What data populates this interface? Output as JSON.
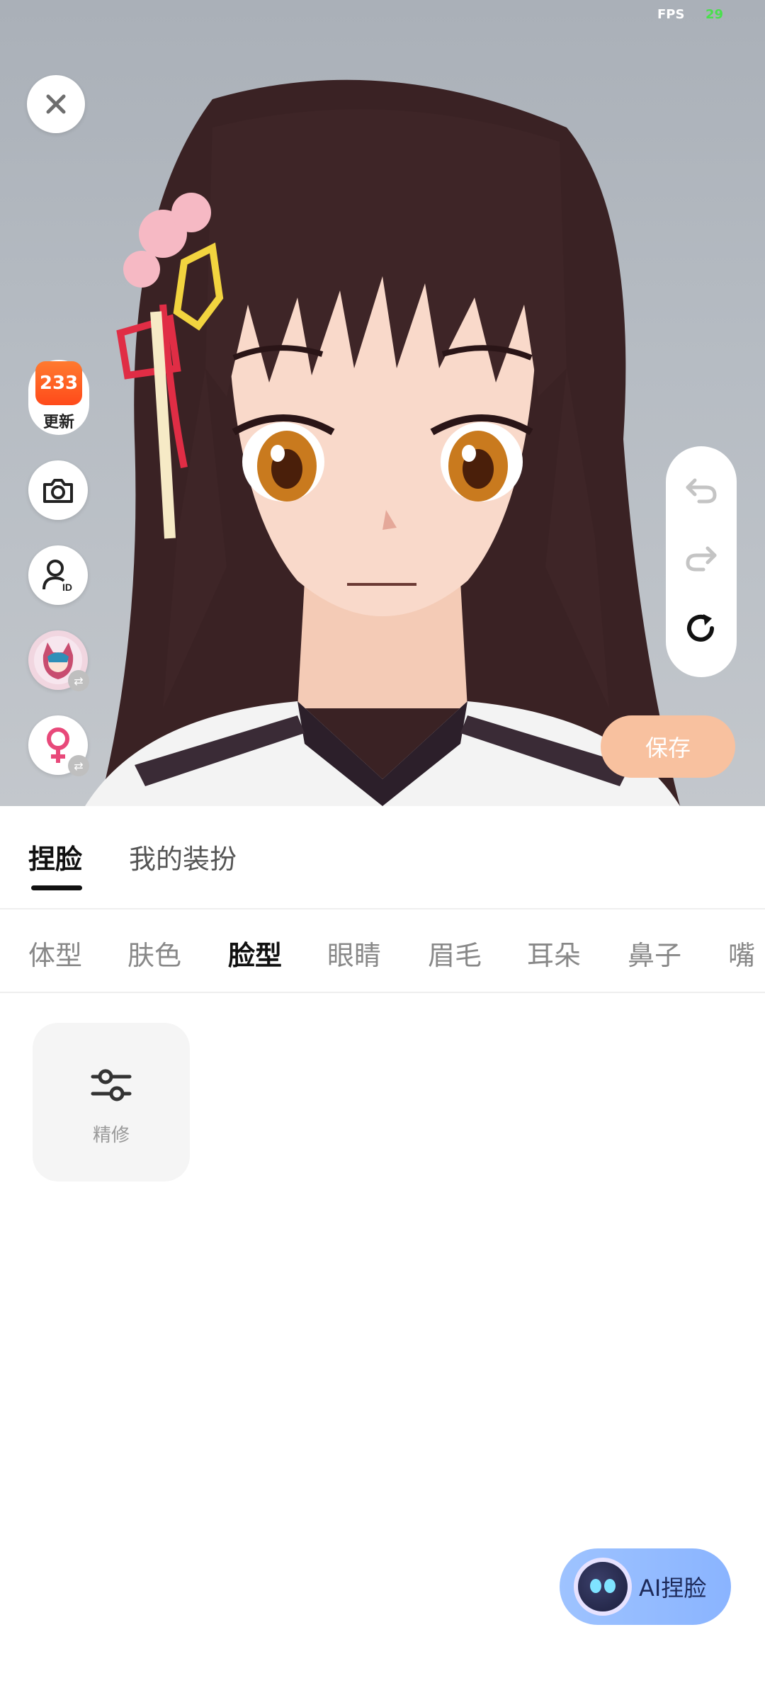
{
  "status": {
    "fps_label": "FPS",
    "fps_value": "29"
  },
  "side_toolbar": {
    "app_badge_number": "233",
    "app_badge_label": "更新",
    "icons": [
      "camera-icon",
      "id-card-icon",
      "avatar-thumbnail",
      "gender-female-icon"
    ]
  },
  "history": {
    "undo": "undo-icon",
    "redo": "redo-icon",
    "reset": "reset-icon"
  },
  "save_label": "保存",
  "tabs": [
    {
      "label": "捏脸",
      "active": true
    },
    {
      "label": "我的装扮",
      "active": false
    }
  ],
  "categories": [
    {
      "label": "体型",
      "active": false
    },
    {
      "label": "肤色",
      "active": false
    },
    {
      "label": "脸型",
      "active": true
    },
    {
      "label": "眼睛",
      "active": false
    },
    {
      "label": "眉毛",
      "active": false
    },
    {
      "label": "耳朵",
      "active": false
    },
    {
      "label": "鼻子",
      "active": false
    },
    {
      "label": "嘴",
      "active": false
    }
  ],
  "options": [
    {
      "label": "精修",
      "icon": "sliders-icon"
    }
  ],
  "ai_button_label": "AI捏脸",
  "colors": {
    "accent_save": "#f8c19f",
    "ai_button": "#8ab4ff",
    "fps_green": "#49e04c"
  }
}
